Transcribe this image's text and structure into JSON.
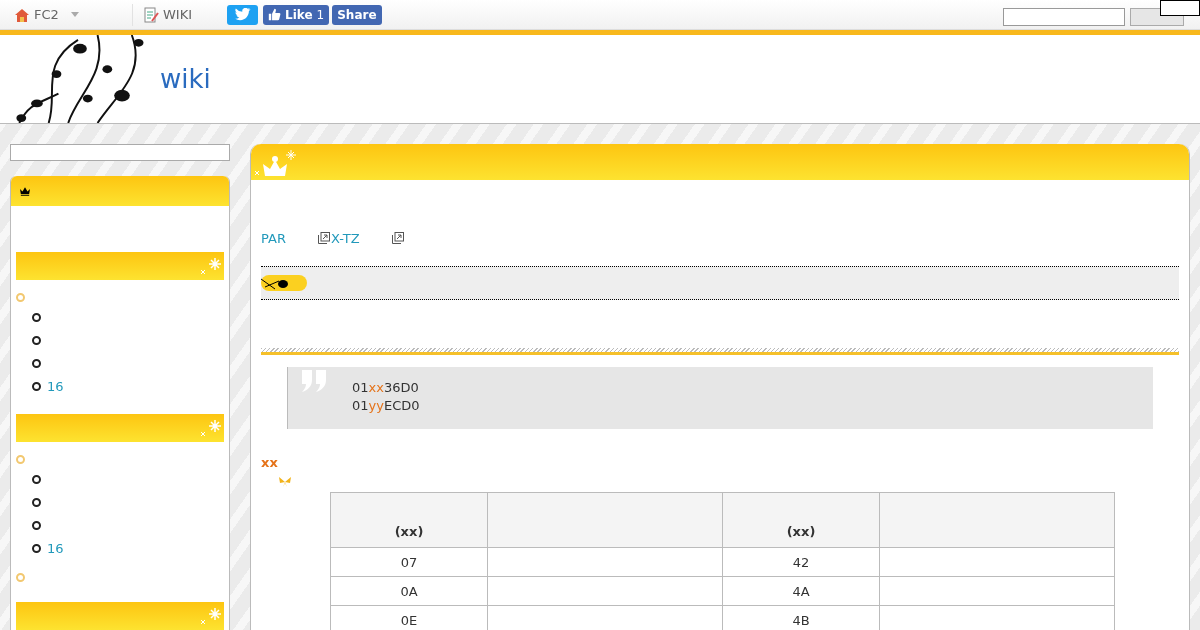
{
  "topbar": {
    "items": [
      {
        "kind": "home",
        "label": "FC2",
        "dropdown": true
      },
      {
        "kind": "wiki",
        "label": "WIKI",
        "dropdown": false
      }
    ],
    "social": {
      "like_label": "Like",
      "like_count": "1",
      "share_label": "Share"
    }
  },
  "header": {
    "title": "wiki"
  },
  "sidebar": {
    "sections": [
      {
        "kind": "list",
        "groups": [
          {
            "kind": "group",
            "children": [
              {
                "kind": "bullet"
              },
              {
                "kind": "bullet"
              },
              {
                "kind": "bullet"
              },
              {
                "kind": "link",
                "label": "16"
              }
            ]
          }
        ]
      },
      {
        "kind": "list",
        "groups": [
          {
            "kind": "group",
            "children": [
              {
                "kind": "bullet"
              },
              {
                "kind": "bullet"
              },
              {
                "kind": "bullet"
              },
              {
                "kind": "link",
                "label": "16"
              }
            ]
          },
          {
            "kind": "bullet"
          }
        ]
      },
      {
        "kind": "header_only"
      }
    ]
  },
  "main": {
    "links": [
      {
        "label": "PAR",
        "external": false
      },
      {
        "label": "X-TZ",
        "external": true
      },
      {
        "external": true
      }
    ],
    "quote": [
      [
        {
          "text": "01",
          "highlight": false
        },
        {
          "text": "xx",
          "highlight": true
        },
        {
          "text": "36D0",
          "highlight": false
        }
      ],
      [
        {
          "text": "01",
          "highlight": false
        },
        {
          "text": "yy",
          "highlight": true
        },
        {
          "text": "ECD0",
          "highlight": false
        }
      ]
    ],
    "heading": "xx",
    "table": {
      "columns": [
        {
          "label": "(xx)"
        },
        {},
        {
          "label": "(xx)"
        },
        {}
      ],
      "rows": [
        {
          "column_1": "07",
          "column_3": "42"
        },
        {
          "column_1": "0A",
          "column_3": "4A"
        },
        {
          "column_1": "0E",
          "column_3": "4B"
        }
      ]
    }
  }
}
